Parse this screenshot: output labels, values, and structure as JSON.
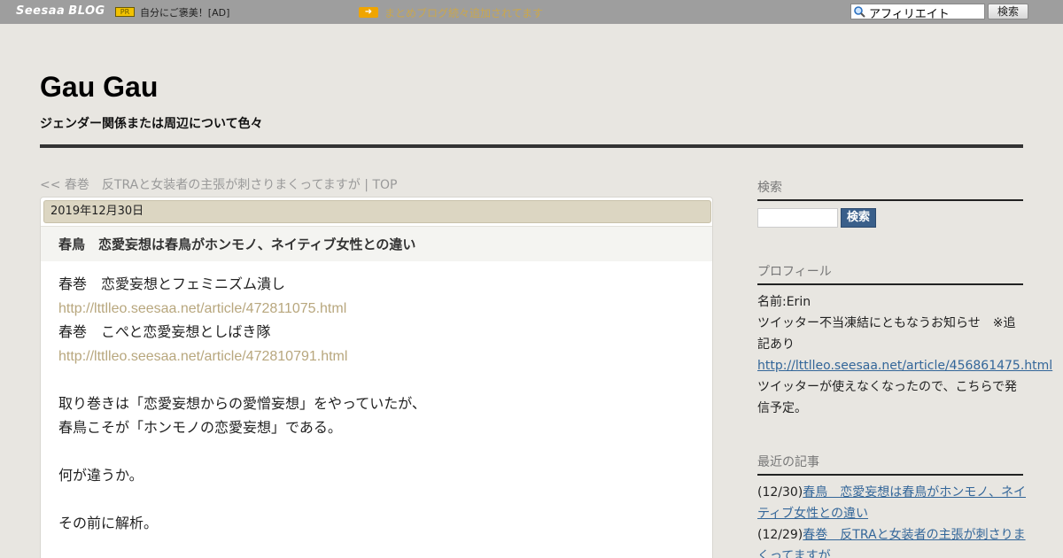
{
  "topbar": {
    "logo_primary": "Seesaa",
    "logo_secondary": "BLOG",
    "pr_badge": "PR",
    "pr_text": "自分にご褒美！[AD]",
    "notice": "まとめブログ続々追加されてます",
    "search_value": "アフィリエイト",
    "search_button": "検索"
  },
  "header": {
    "title": "Gau Gau",
    "description": "ジェンダー関係または周辺について色々"
  },
  "article_nav": {
    "prev_link": "<< 春巻　反TRAと女装者の主張が刺さりまくってますが",
    "separator": "|",
    "top_link": "TOP"
  },
  "article": {
    "date": "2019年12月30日",
    "title": "春鳥　恋愛妄想は春鳥がホンモノ、ネイティブ女性との違い",
    "body": [
      {
        "text": "春巻　恋愛妄想とフェミニズム潰し",
        "link": false
      },
      {
        "text": "http://lttlleo.seesaa.net/article/472811075.html",
        "link": true
      },
      {
        "text": "春巻　こぺと恋愛妄想としばき隊",
        "link": false
      },
      {
        "text": "http://lttlleo.seesaa.net/article/472810791.html",
        "link": true
      },
      {
        "text": "",
        "link": false
      },
      {
        "text": "取り巻きは「恋愛妄想からの愛憎妄想」をやっていたが、",
        "link": false
      },
      {
        "text": "春鳥こそが「ホンモノの恋愛妄想」である。",
        "link": false
      },
      {
        "text": "",
        "link": false
      },
      {
        "text": "何が違うか。",
        "link": false
      },
      {
        "text": "",
        "link": false
      },
      {
        "text": "その前に解析。",
        "link": false
      }
    ]
  },
  "sidebar": {
    "search": {
      "heading": "検索",
      "button": "検索"
    },
    "profile": {
      "heading": "プロフィール",
      "name": "名前:Erin",
      "notice_line1": "ツイッター不当凍結にともなうお知らせ　※追",
      "notice_line2": "記あり",
      "notice_link": "http://lttlleo.seesaa.net/article/456861475.html",
      "note_line1": "ツイッターが使えなくなったので、こちらで発",
      "note_line2": "信予定。"
    },
    "recent": {
      "heading": "最近の記事",
      "items": [
        {
          "date": "(12/30)",
          "title_line1": "春鳥　恋愛妄想は春鳥がホンモノ、ネイ",
          "title_line2": "ティブ女性との違い"
        },
        {
          "date": "(12/29)",
          "title_line1": "春巻　反TRAと女装者の主張が刺さりま",
          "title_line2": "くってますが"
        }
      ]
    }
  }
}
